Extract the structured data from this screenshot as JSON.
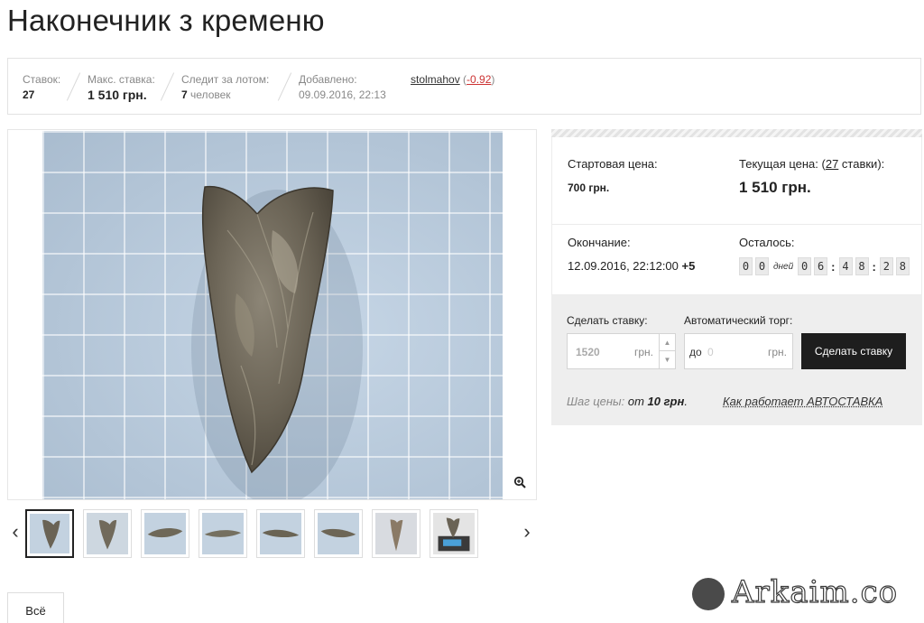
{
  "page": {
    "title": "Наконечник з кременю"
  },
  "info": {
    "bids_label": "Ставок:",
    "bids_value": "27",
    "max_label": "Макс. ставка:",
    "max_value": "1 510 грн.",
    "watch_label": "Следит за лотом:",
    "watch_count": "7",
    "watch_unit": "человек",
    "added_label": "Добавлено:",
    "added_value": "09.09.2016, 22:13",
    "seller_name": "stolmahov",
    "seller_rating": "-0.92"
  },
  "prices": {
    "start_label": "Стартовая цена:",
    "start_value": "700 грн.",
    "current_label": "Текущая цена: (",
    "current_bids": "27",
    "current_label_tail": " ставки):",
    "current_value": "1 510 грн.",
    "end_label": "Окончание:",
    "end_value": "12.09.2016, 22:12:00",
    "end_tz": "+5",
    "left_label": "Осталось:",
    "timer": {
      "d1": "0",
      "d2": "0",
      "days": "дней",
      "h1": "0",
      "h2": "6",
      "m1": "4",
      "m2": "8",
      "s1": "2",
      "s2": "8",
      "colon": ":"
    }
  },
  "bid": {
    "make_label": "Сделать ставку:",
    "amount": "1520",
    "currency": "грн.",
    "auto_label": "Автоматический торг:",
    "auto_prefix": "до",
    "auto_placeholder": "0",
    "button": "Сделать ставку",
    "step_label": "Шаг цены:",
    "step_from": "от",
    "step_value": "10 грн",
    "step_dot": ".",
    "howto": "Как работает АВТОСТАВКА"
  },
  "gallery": {
    "all_button": "Всё",
    "zoom_icon": "zoom-in-icon",
    "thumb_count": 8
  },
  "watermark": {
    "text": "Arkaim.co"
  },
  "colors": {
    "rating": "#cc3333",
    "button_bg": "#1e1e1e"
  }
}
